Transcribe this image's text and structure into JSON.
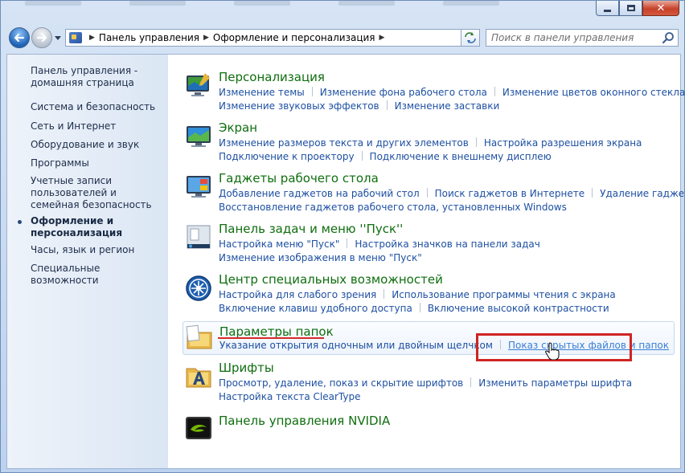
{
  "window": {
    "buttons": {
      "close": "✕"
    }
  },
  "address": {
    "crumbs": [
      "Панель управления",
      "Оформление и персонализация"
    ],
    "search_placeholder": "Поиск в панели управления"
  },
  "sidebar": {
    "items": [
      {
        "label": "Панель управления - домашняя страница",
        "active": false
      },
      {
        "label": "Система и безопасность",
        "active": false
      },
      {
        "label": "Сеть и Интернет",
        "active": false
      },
      {
        "label": "Оборудование и звук",
        "active": false
      },
      {
        "label": "Программы",
        "active": false
      },
      {
        "label": "Учетные записи пользователей и семейная безопасность",
        "active": false
      },
      {
        "label": "Оформление и персонализация",
        "active": true
      },
      {
        "label": "Часы, язык и регион",
        "active": false
      },
      {
        "label": "Специальные возможности",
        "active": false
      }
    ]
  },
  "categories": [
    {
      "title": "Персонализация",
      "icon": "personalization-icon",
      "links": [
        [
          "Изменение темы",
          "Изменение фона рабочего стола",
          "Изменение цветов оконного стекла"
        ],
        [
          "Изменение звуковых эффектов",
          "Изменение заставки"
        ]
      ]
    },
    {
      "title": "Экран",
      "icon": "display-icon",
      "links": [
        [
          "Изменение размеров текста и других элементов",
          "Настройка разрешения экрана"
        ],
        [
          "Подключение к проектору",
          "Подключение к внешнему дисплею"
        ]
      ]
    },
    {
      "title": "Гаджеты рабочего стола",
      "icon": "gadgets-icon",
      "links": [
        [
          "Добавление гаджетов на рабочий стол",
          "Поиск гаджетов в Интернете",
          "Удаление гаджетов"
        ],
        [
          "Восстановление гаджетов рабочего стола, установленных Windows"
        ]
      ]
    },
    {
      "title": "Панель задач и меню ''Пуск''",
      "icon": "taskbar-icon",
      "links": [
        [
          "Настройка меню \"Пуск\"",
          "Настройка значков на панели задач"
        ],
        [
          "Изменение изображения в меню \"Пуск\""
        ]
      ]
    },
    {
      "title": "Центр специальных возможностей",
      "icon": "ease-of-access-icon",
      "links": [
        [
          "Настройка для слабого зрения",
          "Использование программы чтения с экрана"
        ],
        [
          "Включение клавиш удобного доступа",
          "Включение высокой контрастности"
        ]
      ]
    },
    {
      "title": "Параметры папок",
      "icon": "folder-options-icon",
      "links": [
        [
          "Указание открытия одночным или двойным щелчком",
          "Показ скрытых файлов и папок"
        ]
      ]
    },
    {
      "title": "Шрифты",
      "icon": "fonts-icon",
      "links": [
        [
          "Просмотр, удаление, показ и скрытие шрифтов",
          "Изменить параметры шрифта"
        ],
        [
          "Настройка текста ClearType"
        ]
      ]
    },
    {
      "title": "Панель управления NVIDIA",
      "icon": "nvidia-icon",
      "links": []
    }
  ],
  "colors": {
    "title_green": "#0f6e0f",
    "link_blue": "#1e50a2",
    "highlight_red": "#cf2424"
  }
}
